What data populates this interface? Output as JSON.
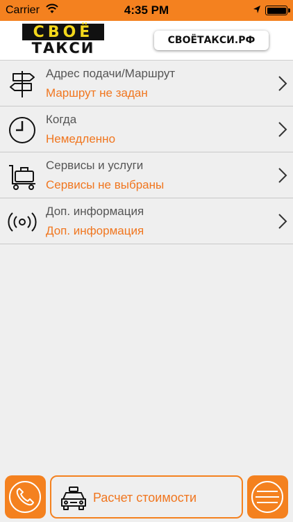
{
  "status_bar": {
    "carrier": "Carrier",
    "time": "4:35 PM",
    "icons": [
      "wifi-icon",
      "location-arrow-icon",
      "battery-icon"
    ]
  },
  "header": {
    "logo_top": "СВОЁ",
    "logo_bottom": "ТАКСИ",
    "site_badge": "СВОЁТАКСИ.РФ"
  },
  "menu": [
    {
      "icon": "signpost-icon",
      "title": "Адрес подачи/Маршрут",
      "value": "Маршрут не задан"
    },
    {
      "icon": "clock-icon",
      "title": "Когда",
      "value": "Немедленно"
    },
    {
      "icon": "luggage-cart-icon",
      "title": "Сервисы и услуги",
      "value": "Сервисы не выбраны"
    },
    {
      "icon": "broadcast-icon",
      "title": "Доп. информация",
      "value": "Доп. информация"
    }
  ],
  "bottom_bar": {
    "call_icon": "phone-icon",
    "calc_label": "Расчет стоимости",
    "calc_icon": "taxi-icon",
    "menu_icon": "hamburger-icon"
  },
  "colors": {
    "accent": "#f4811f",
    "value_text": "#f0761f",
    "background": "#efefef"
  }
}
